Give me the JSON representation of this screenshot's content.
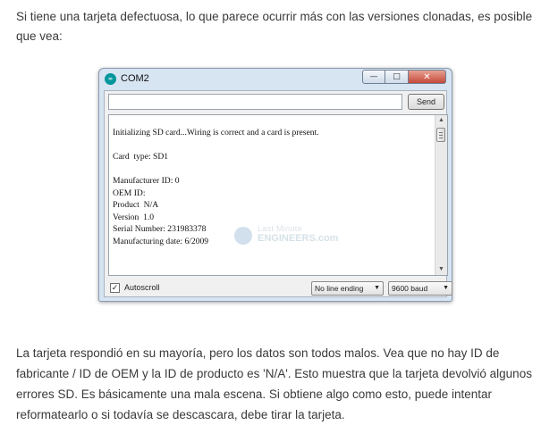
{
  "article": {
    "intro": "Si tiene una tarjeta defectuosa, lo que parece ocurrir más con las versiones clonadas, es posible que vea:",
    "conclusion": "La tarjeta respondió en su mayoría, pero los datos son todos malos. Vea que no hay ID de fabricante / ID de OEM y la ID de producto es 'N/A'. Esto muestra que la tarjeta devolvió algunos errores SD. Es básicamente una mala escena. Si obtiene algo como esto, puede intentar reformatearlo o si todavía se descascara, debe tirar la tarjeta."
  },
  "window": {
    "title": "COM2",
    "app_icon_text": "∞",
    "minimize_label": "—",
    "maximize_label": "□",
    "close_label": "✕"
  },
  "serial_monitor": {
    "input_value": "",
    "send_label": "Send",
    "output_lines": "Initializing SD card...Wiring is correct and a card is present.\n\nCard  type: SD1\n\nManufacturer ID: 0\nOEM ID:\nProduct  N/A\nVersion  1.0\nSerial Number: 231983378\nManufacturing date: 6/2009",
    "autoscroll_label": "Autoscroll",
    "autoscroll_checked": true,
    "check_mark": "✓",
    "line_ending": "No line ending",
    "baud_rate": "9600 baud"
  },
  "watermark": {
    "line1": "Last Minute",
    "line2": "ENGINEERS.com"
  },
  "icons": {
    "scroll_up": "▲",
    "scroll_down": "▼",
    "dropdown": "▼"
  },
  "colors": {
    "window_frame": "#d7e4f2",
    "close_button": "#c4493a",
    "arduino_teal": "#00979c"
  }
}
